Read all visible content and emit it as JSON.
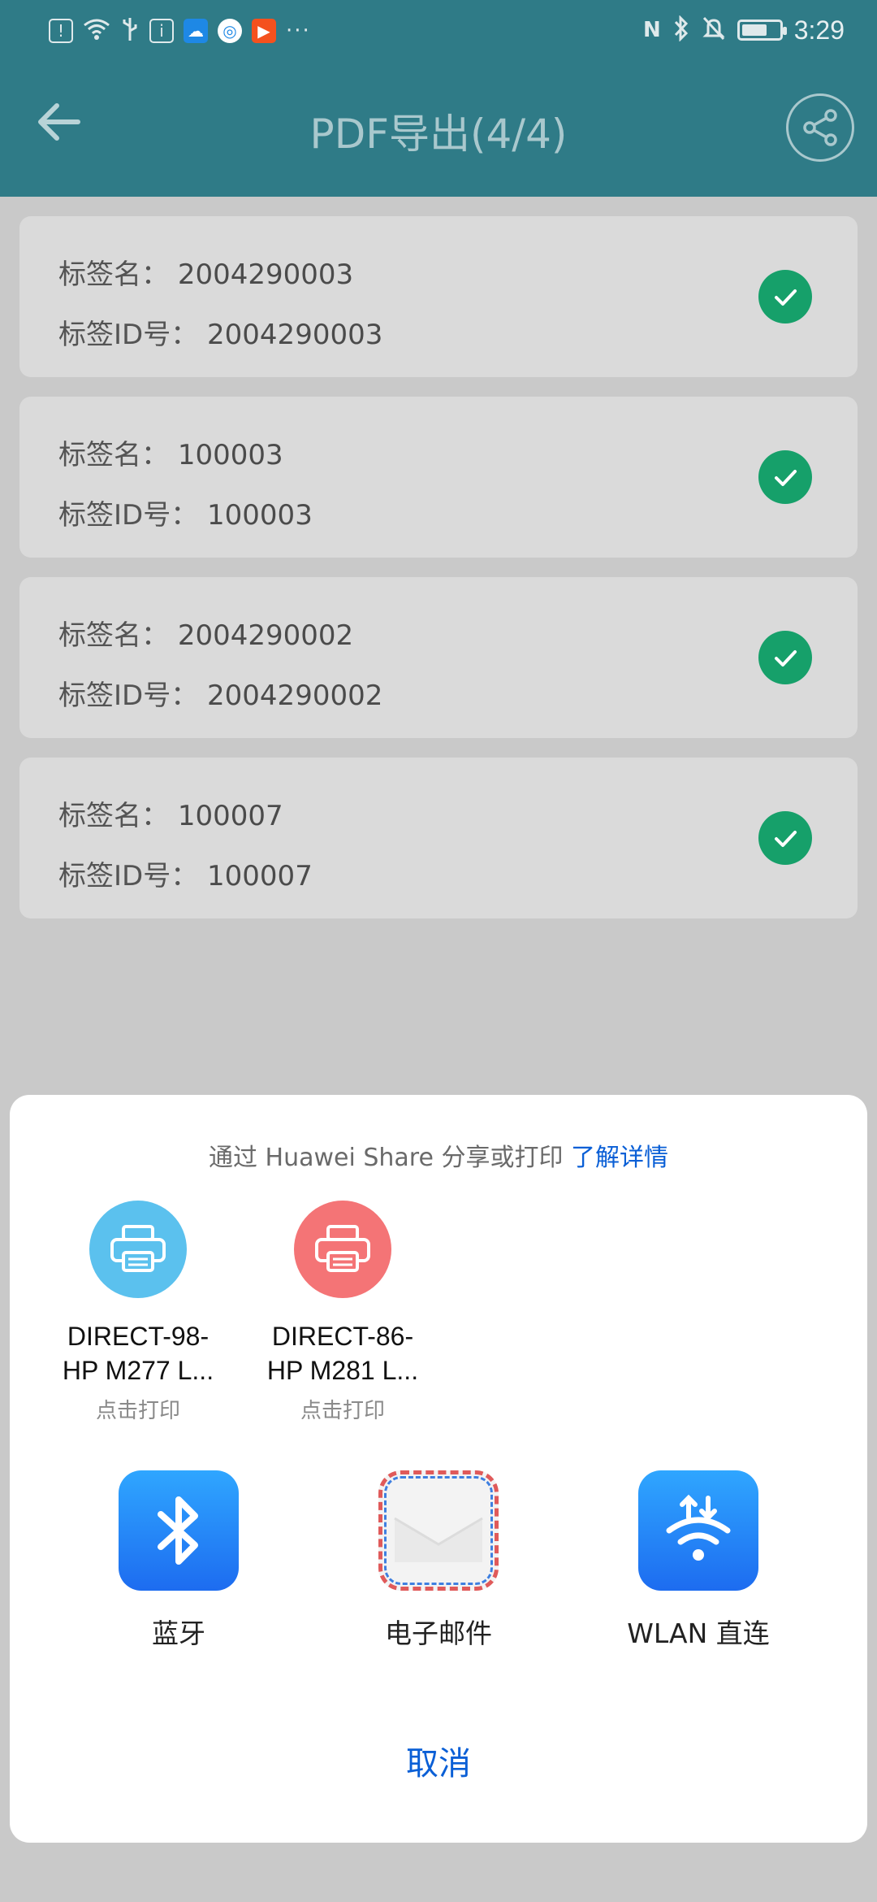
{
  "status_bar": {
    "time": "3:29",
    "left_icons": [
      "alert-sim-icon",
      "wifi-icon",
      "usb-icon",
      "info-app-icon",
      "cloud-app-icon",
      "browser-app-icon",
      "video-app-icon"
    ],
    "more": "···",
    "nfc": "N",
    "right_icons": [
      "bluetooth-icon",
      "mute-icon",
      "battery-icon"
    ]
  },
  "app_bar": {
    "title": "PDF导出(4/4)",
    "back_icon": "arrow-left-icon",
    "share_icon": "share-icon"
  },
  "tags": [
    {
      "name_label": "标签名：",
      "name_value": "2004290003",
      "id_label": "标签ID号：",
      "id_value": "2004290003",
      "status": "done"
    },
    {
      "name_label": "标签名：",
      "name_value": "100003",
      "id_label": "标签ID号：",
      "id_value": "100003",
      "status": "done"
    },
    {
      "name_label": "标签名：",
      "name_value": "2004290002",
      "id_label": "标签ID号：",
      "id_value": "2004290002",
      "status": "done"
    },
    {
      "name_label": "标签名：",
      "name_value": "100007",
      "id_label": "标签ID号：",
      "id_value": "100007",
      "status": "done"
    }
  ],
  "share_sheet": {
    "hint_text": "通过 Huawei Share 分享或打印",
    "hint_link": "了解详情",
    "printers": [
      {
        "line1": "DIRECT-98-",
        "line2": "HP M277 L...",
        "sub": "点击打印",
        "color": "#5bc1ee"
      },
      {
        "line1": "DIRECT-86-",
        "line2": "HP M281 L...",
        "sub": "点击打印",
        "color": "#f47476"
      }
    ],
    "apps": [
      {
        "label": "蓝牙",
        "icon": "bluetooth-icon"
      },
      {
        "label": "电子邮件",
        "icon": "email-icon"
      },
      {
        "label": "WLAN 直连",
        "icon": "wlan-direct-icon"
      }
    ],
    "cancel": "取消"
  },
  "colors": {
    "header": "#2f7b87",
    "check": "#16a06a",
    "link": "#0a5fd6"
  }
}
